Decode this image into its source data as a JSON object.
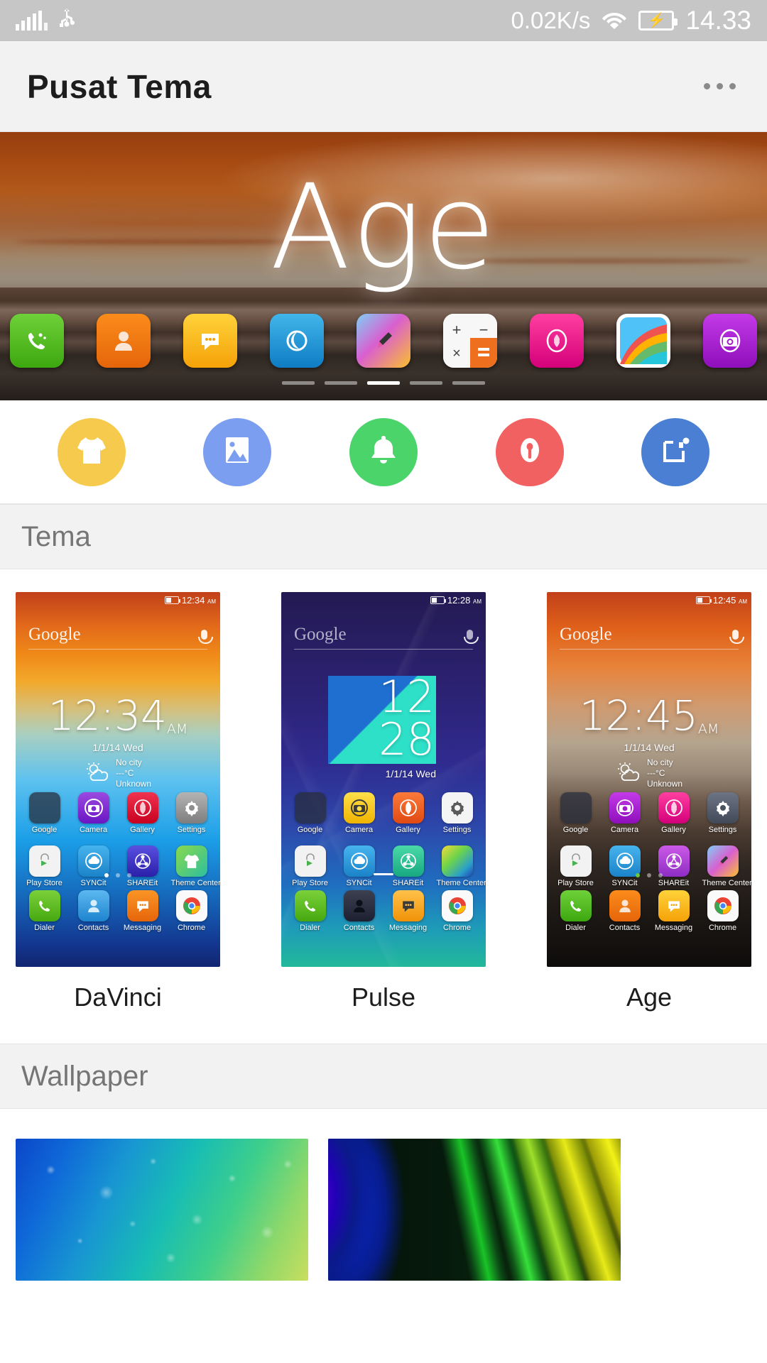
{
  "status_bar": {
    "signal_icon": "signal-bars-icon",
    "usb_icon": "usb-icon",
    "network_speed": "0.02K/s",
    "wifi_icon": "wifi-icon",
    "battery_icon": "battery-charging-icon",
    "clock": "14.33"
  },
  "app_bar": {
    "title": "Pusat Tema",
    "overflow_label": "overflow-menu"
  },
  "banner": {
    "theme_name": "Age",
    "dock_icons": [
      {
        "name": "phone-icon",
        "color": "#4fbd1f",
        "glyph": "☎"
      },
      {
        "name": "contacts-icon",
        "color": "#f07a0c",
        "glyph": "●"
      },
      {
        "name": "messaging-icon",
        "color": "#fbbd08",
        "glyph": "●"
      },
      {
        "name": "browser-icon",
        "color": "#1b8fd4",
        "glyph": "●"
      },
      {
        "name": "paint-icon",
        "color": "#e8549d",
        "glyph": "✐"
      },
      {
        "name": "calculator-icon",
        "color": "#f6f6f6",
        "glyph": "+"
      },
      {
        "name": "gallery-icon",
        "color": "#ee1289",
        "glyph": "❀"
      },
      {
        "name": "colors-icon",
        "color": "#5bc8f5",
        "glyph": "●"
      },
      {
        "name": "camera-icon",
        "color": "#a21ccd",
        "glyph": "◎"
      }
    ],
    "page_dots": 5,
    "active_page": 3
  },
  "categories": [
    {
      "name": "category-theme",
      "label": "Theme",
      "color": "#f6cb4d",
      "icon": "tshirt-icon"
    },
    {
      "name": "category-wallpaper",
      "label": "Wallpaper",
      "color": "#7b9ef0",
      "icon": "image-icon"
    },
    {
      "name": "category-ringtone",
      "label": "Ringtone",
      "color": "#4ad46a",
      "icon": "bell-icon"
    },
    {
      "name": "category-lock",
      "label": "Lockscreen",
      "color": "#f26161",
      "icon": "lock-key-icon"
    },
    {
      "name": "category-widget",
      "label": "Widget",
      "color": "#4a7fd4",
      "icon": "widget-icon"
    }
  ],
  "sections": {
    "theme_title": "Tema",
    "wallpaper_title": "Wallpaper"
  },
  "themes": [
    {
      "name": "DaVinci",
      "status_time": "12:34",
      "status_ampm": "AM",
      "search_text": "Google",
      "clock_time": "12:34",
      "clock_ampm": "AM",
      "date": "1/1/14  Wed",
      "weather_city": "No city",
      "weather_temp": "---°C",
      "weather_cond": "Unknown",
      "bg_kind": "sunset-blue-gradient",
      "apps_row1": [
        {
          "label": "Google",
          "icon": "google-folder-icon",
          "color": "#3e4a5e"
        },
        {
          "label": "Camera",
          "icon": "camera-icon",
          "color": "#7b2fd4"
        },
        {
          "label": "Gallery",
          "icon": "gallery-icon",
          "color": "#e8203f"
        },
        {
          "label": "Settings",
          "icon": "settings-icon",
          "color": "#9a9a9a"
        }
      ],
      "apps_row2": [
        {
          "label": "Play Store",
          "icon": "play-store-icon",
          "color": "#f2f2f2"
        },
        {
          "label": "SYNCit",
          "icon": "syncit-icon",
          "color": "#2a9ae0"
        },
        {
          "label": "SHAREit",
          "icon": "shareit-icon",
          "color": "#3a35c4"
        },
        {
          "label": "Theme Center",
          "icon": "theme-center-icon",
          "color": "#6ec83a"
        }
      ],
      "dock": [
        {
          "label": "Dialer",
          "icon": "phone-icon",
          "color": "#5cbb28"
        },
        {
          "label": "Contacts",
          "icon": "contacts-icon",
          "color": "#3a9fe0"
        },
        {
          "label": "Messaging",
          "icon": "messaging-icon",
          "color": "#f07a0c"
        },
        {
          "label": "Chrome",
          "icon": "chrome-icon",
          "color": "#f5f5f5"
        }
      ],
      "page_dots": 3,
      "active_dot": 1
    },
    {
      "name": "Pulse",
      "status_time": "12:28",
      "status_ampm": "AM",
      "search_text": "Google",
      "clock_time": "12\n28",
      "clock_ampm": "",
      "date": "1/1/14  Wed",
      "weather_city": "",
      "weather_temp": "",
      "weather_cond": "",
      "bg_kind": "indigo-facets",
      "apps_row1": [
        {
          "label": "Google",
          "icon": "google-folder-icon",
          "color": "#3e4a5e"
        },
        {
          "label": "Camera",
          "icon": "camera-icon",
          "color": "#f2c811"
        },
        {
          "label": "Gallery",
          "icon": "gallery-icon",
          "color": "#f05a28"
        },
        {
          "label": "Settings",
          "icon": "settings-icon",
          "color": "#f2f2f2"
        }
      ],
      "apps_row2": [
        {
          "label": "Play Store",
          "icon": "play-store-icon",
          "color": "#f2f2f2"
        },
        {
          "label": "SYNCit",
          "icon": "syncit-icon",
          "color": "#2a9ae0"
        },
        {
          "label": "SHAREit",
          "icon": "shareit-icon",
          "color": "#2bc48a"
        },
        {
          "label": "Theme Center",
          "icon": "theme-center-icon",
          "color": "#4ad46a"
        }
      ],
      "dock": [
        {
          "label": "Dialer",
          "icon": "phone-icon",
          "color": "#5cbb28"
        },
        {
          "label": "Contacts",
          "icon": "contacts-icon",
          "color": "#2a2a3a"
        },
        {
          "label": "Messaging",
          "icon": "messaging-icon",
          "color": "#f5a623"
        },
        {
          "label": "Chrome",
          "icon": "chrome-icon",
          "color": "#f5f5f5"
        }
      ],
      "page_dots": 1,
      "active_dot": 1
    },
    {
      "name": "Age",
      "status_time": "12:45",
      "status_ampm": "AM",
      "search_text": "Google",
      "clock_time": "12:45",
      "clock_ampm": "AM",
      "date": "1/1/14  Wed",
      "weather_city": "No city",
      "weather_temp": "---°C",
      "weather_cond": "Unknown",
      "bg_kind": "sunset-beach",
      "apps_row1": [
        {
          "label": "Google",
          "icon": "google-folder-icon",
          "color": "#3e4a5e"
        },
        {
          "label": "Camera",
          "icon": "camera-icon",
          "color": "#a21ccd"
        },
        {
          "label": "Gallery",
          "icon": "gallery-icon",
          "color": "#ee1289"
        },
        {
          "label": "Settings",
          "icon": "settings-icon",
          "color": "#586070"
        }
      ],
      "apps_row2": [
        {
          "label": "Play Store",
          "icon": "play-store-icon",
          "color": "#f2f2f2"
        },
        {
          "label": "SYNCit",
          "icon": "syncit-icon",
          "color": "#2a9ae0"
        },
        {
          "label": "SHAREit",
          "icon": "shareit-icon",
          "color": "#b040d8"
        },
        {
          "label": "Theme Center",
          "icon": "theme-center-icon",
          "color": "#e8549d"
        }
      ],
      "dock": [
        {
          "label": "Dialer",
          "icon": "phone-icon",
          "color": "#4fbd1f"
        },
        {
          "label": "Contacts",
          "icon": "contacts-icon",
          "color": "#f07a0c"
        },
        {
          "label": "Messaging",
          "icon": "messaging-icon",
          "color": "#fbbd08"
        },
        {
          "label": "Chrome",
          "icon": "chrome-icon",
          "color": "#f5f5f5"
        }
      ],
      "page_dots": 3,
      "active_dot": 1
    }
  ],
  "wallpapers": [
    {
      "name": "wallpaper-waterdrops",
      "kind": "blue-green-water-droplets"
    },
    {
      "name": "wallpaper-curves",
      "kind": "blue-green-yellow-curves"
    }
  ]
}
